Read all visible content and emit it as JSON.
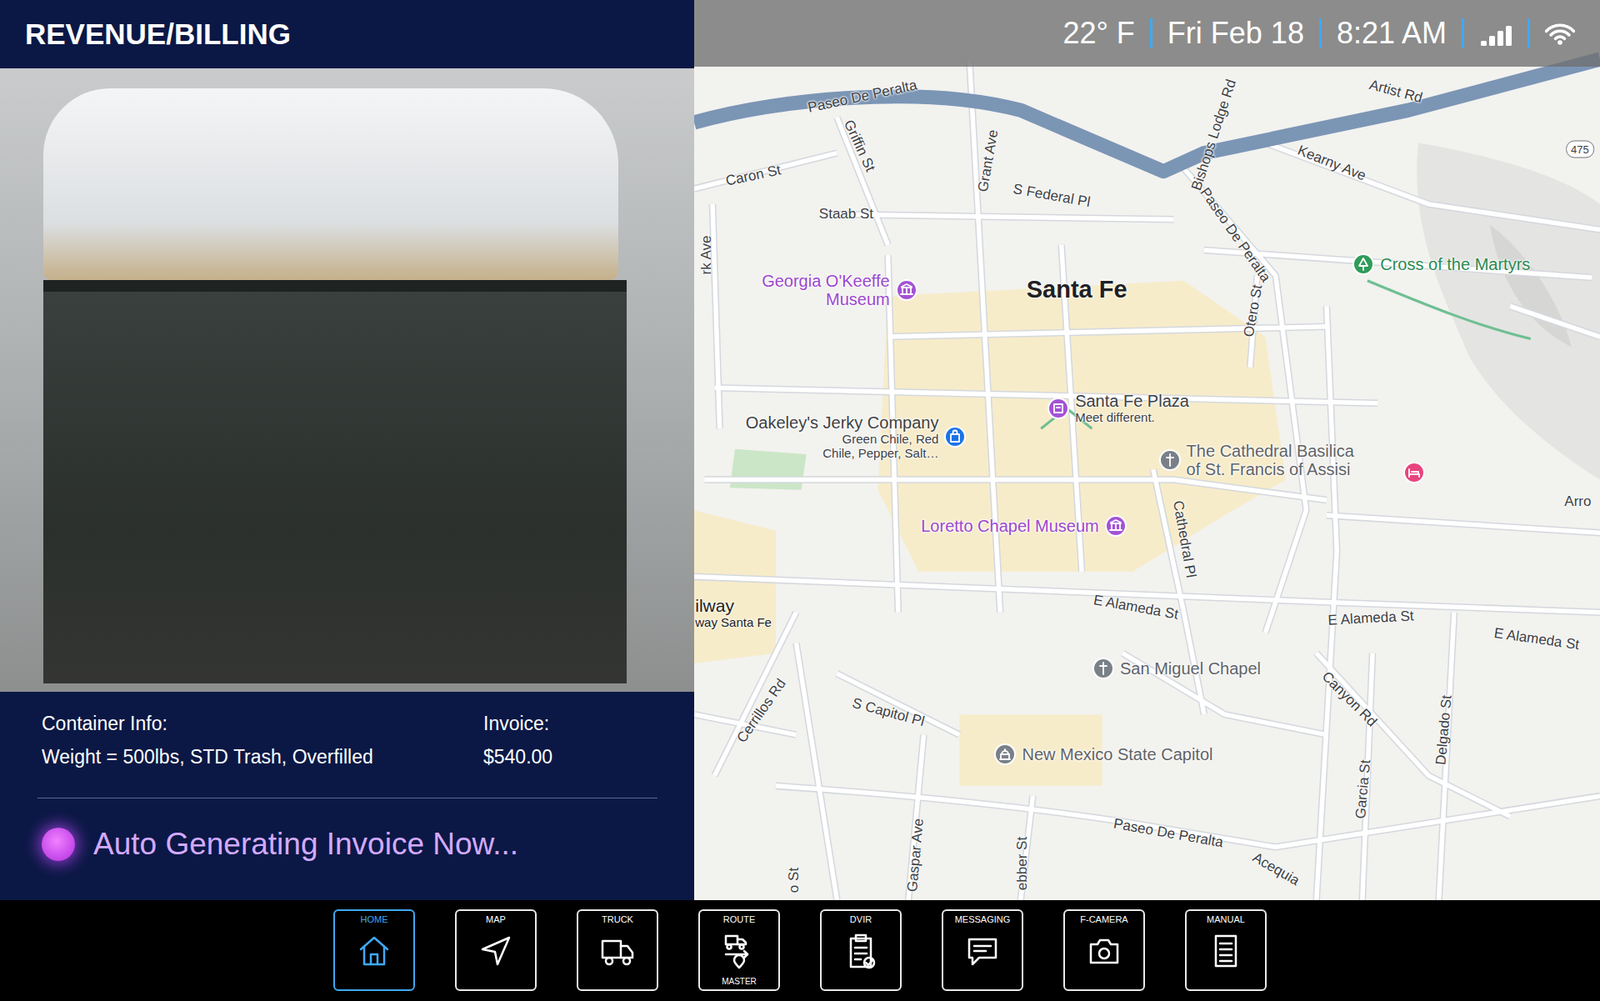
{
  "header": {
    "title": "REVENUE/BILLING"
  },
  "container_info": {
    "label": "Container Info:",
    "value": "Weight = 500lbs, STD Trash, Overfilled"
  },
  "invoice": {
    "label": "Invoice:",
    "value": "$540.00"
  },
  "progress": {
    "text": "Auto Generating Invoice Now...",
    "active": true
  },
  "status_bar": {
    "temperature": "22° F",
    "date": "Fri Feb 18",
    "time": "8:21 AM",
    "signal": {
      "level": 1
    },
    "wifi": {
      "level": 1
    }
  },
  "map": {
    "city": "Santa Fe",
    "highway_shield": "475",
    "streets": [
      "Paseo De Peralta",
      "Bishops Lodge Rd",
      "Artist Rd",
      "Kearny Ave",
      "Caron St",
      "Griffin St",
      "Staab St",
      "Grant Ave",
      "S Federal Pl",
      "Paseo De Peralta",
      "rk Ave",
      "Otero St",
      "Arro",
      "Cathedral Pl",
      "E Alameda St",
      "E Alameda St",
      "E Alameda St",
      "Cerrillos Rd",
      "S Capitol Pl",
      "Canyon Rd",
      "Delgado St",
      "Garcia St",
      "Paseo De Peralta",
      "Gaspar Ave",
      "ebber St",
      "o St",
      "Acequia"
    ],
    "places": [
      {
        "lines": [
          "Georgia O'Keeffe",
          "Museum"
        ],
        "subtitle": [],
        "color": "#a452d6",
        "label_color": "#9b47cf"
      },
      {
        "lines": [
          "Cross of the Martyrs"
        ],
        "subtitle": [],
        "color": "#2f9c5a",
        "label_color": "#2a8a50"
      },
      {
        "lines": [
          "Santa Fe Plaza"
        ],
        "subtitle": [
          "Meet different."
        ],
        "color": "#a452d6",
        "label_color": "#3c4043"
      },
      {
        "lines": [
          "Oakeley's Jerky Company"
        ],
        "subtitle": [
          "Green Chile, Red",
          "Chile, Pepper, Salt…"
        ],
        "color": "#1a73e8",
        "label_color": "#3c4043"
      },
      {
        "lines": [
          "The Cathedral Basilica",
          "of St. Francis of Assisi"
        ],
        "subtitle": [],
        "color": "#7a8088",
        "label_color": "#5f6368"
      },
      {
        "lines": [],
        "subtitle": [],
        "color": "#e8457e",
        "label_color": "#e8457e"
      },
      {
        "lines": [
          "Loretto Chapel Museum"
        ],
        "subtitle": [],
        "color": "#a452d6",
        "label_color": "#9b47cf"
      },
      {
        "lines": [
          "San Miguel Chapel"
        ],
        "subtitle": [],
        "color": "#7a8088",
        "label_color": "#5f6368"
      },
      {
        "lines": [
          "New Mexico State Capitol"
        ],
        "subtitle": [],
        "color": "#7a8088",
        "label_color": "#5f6368"
      }
    ],
    "railway": {
      "title": "ilway",
      "subtitle": "way Santa Fe"
    }
  },
  "nav": [
    {
      "label": "HOME",
      "sub": "",
      "selected": true
    },
    {
      "label": "MAP",
      "sub": "",
      "selected": false
    },
    {
      "label": "TRUCK",
      "sub": "",
      "selected": false
    },
    {
      "label": "ROUTE",
      "sub": "MASTER",
      "selected": false
    },
    {
      "label": "DVIR",
      "sub": "",
      "selected": false
    },
    {
      "label": "MESSAGING",
      "sub": "",
      "selected": false
    },
    {
      "label": "F-CAMERA",
      "sub": "",
      "selected": false
    },
    {
      "label": "MANUAL",
      "sub": "",
      "selected": false
    }
  ]
}
